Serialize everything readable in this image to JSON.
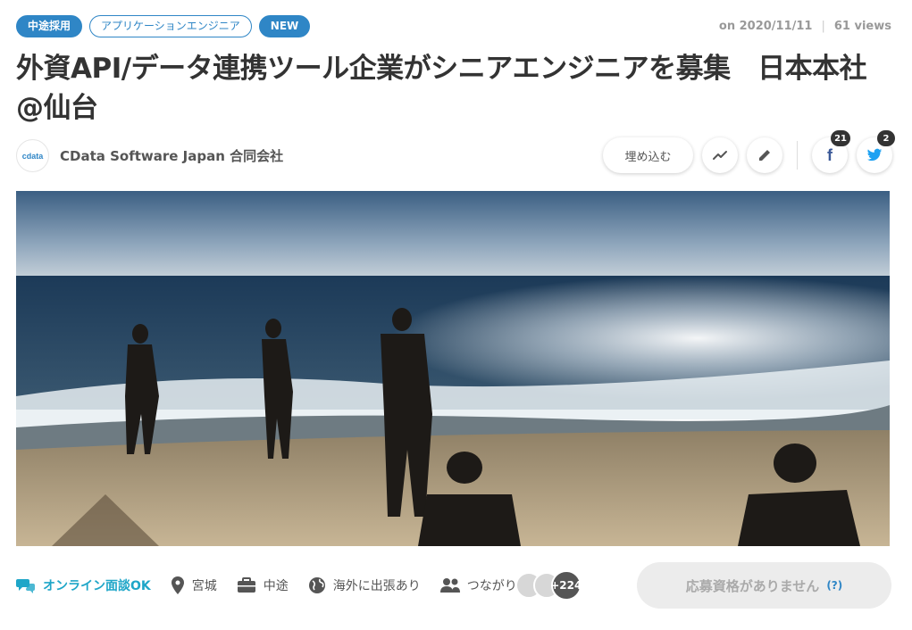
{
  "tags": [
    {
      "label": "中途採用",
      "style": "solid"
    },
    {
      "label": "アプリケーションエンジニア",
      "style": "outline"
    },
    {
      "label": "NEW",
      "style": "solid"
    }
  ],
  "meta": {
    "date": "on 2020/11/11",
    "views": "61 views"
  },
  "title": "外資API/データ連携ツール企業がシニアエンジニアを募集　日本本社@仙台",
  "company": {
    "logo_text": "cdata",
    "name": "CData Software Japan 合同会社"
  },
  "actions": {
    "embed_label": "埋め込む",
    "facebook_count": "21",
    "twitter_count": "2"
  },
  "features": {
    "online": "オンライン面談OK",
    "location": "宮城",
    "employment": "中途",
    "overseas": "海外に出張あり",
    "connections": "つながり",
    "connections_count": "+224"
  },
  "apply": {
    "label": "応募資格がありません",
    "help": "(?)"
  },
  "colors": {
    "accent": "#2f86c6",
    "online": "#1fa6c8",
    "badge": "#333333"
  }
}
